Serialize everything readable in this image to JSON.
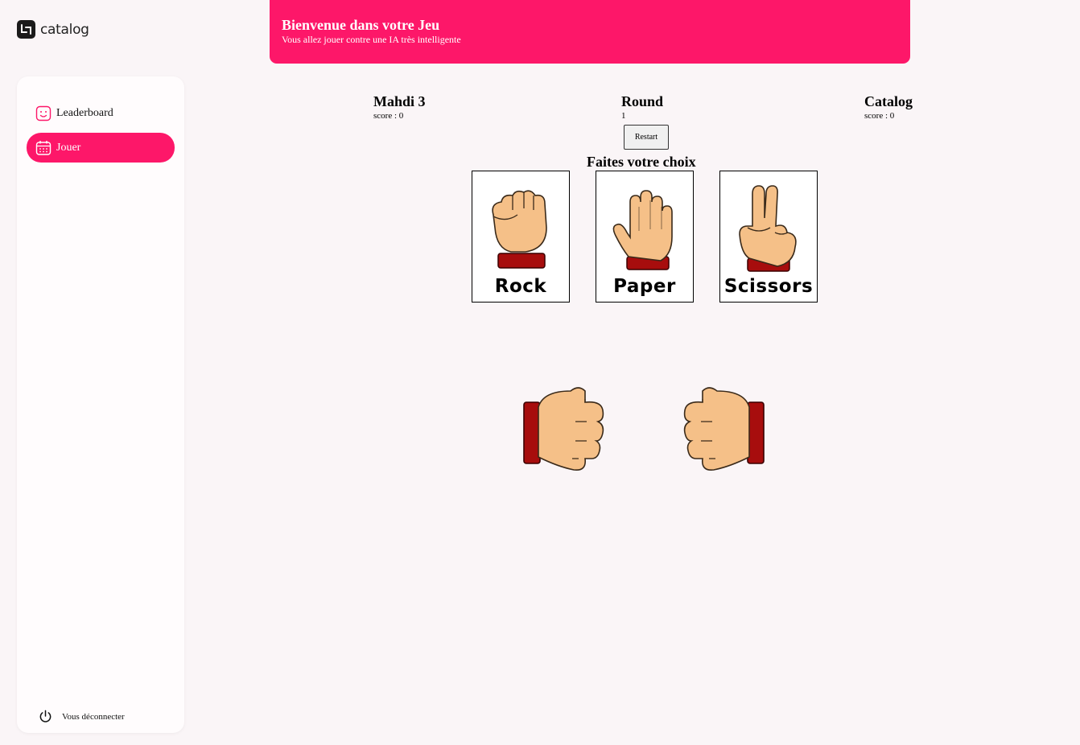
{
  "brand": {
    "logo_text": "catalog"
  },
  "sidebar": {
    "items": [
      {
        "label": "Leaderboard",
        "icon": "smiley-icon",
        "active": false
      },
      {
        "label": "Jouer",
        "icon": "calendar-icon",
        "active": true
      }
    ],
    "logout_label": "Vous déconnecter"
  },
  "banner": {
    "title": "Bienvenue dans votre Jeu",
    "subtitle": "Vous allez jouer contre une IA très intelligente"
  },
  "game": {
    "player": {
      "name": "Mahdi 3",
      "score": "score : 0"
    },
    "round": {
      "label": "Round",
      "value": "1"
    },
    "opponent": {
      "name": "Catalog",
      "score": "score : 0"
    },
    "restart_label": "Restart",
    "choose_title": "Faites votre choix",
    "choices": [
      {
        "label": "Rock",
        "icon": "rock-hand-icon"
      },
      {
        "label": "Paper",
        "icon": "paper-hand-icon"
      },
      {
        "label": "Scissors",
        "icon": "scissors-hand-icon"
      }
    ],
    "battle": {
      "player_hand": "fist-right-icon",
      "opponent_hand": "fist-left-icon"
    }
  },
  "colors": {
    "accent": "#fd1769",
    "background": "#faf5f7",
    "skin": "#f5c088",
    "cuff": "#a70d0d"
  }
}
